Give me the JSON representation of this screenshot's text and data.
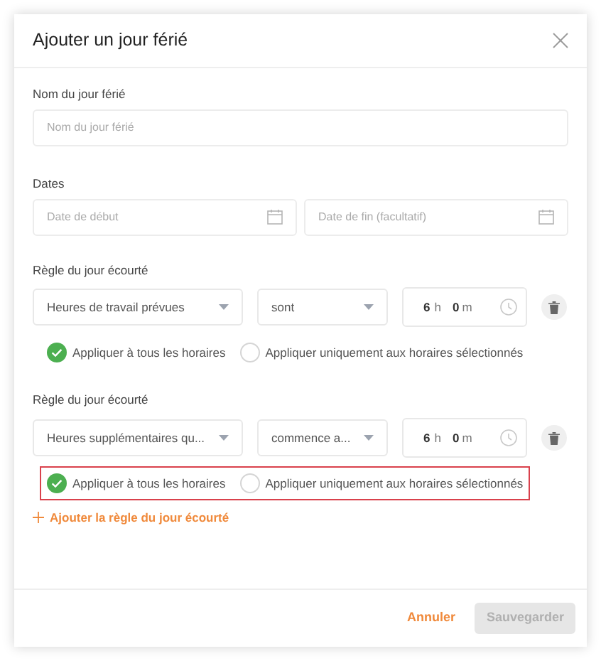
{
  "dialog": {
    "title": "Ajouter un jour férié"
  },
  "name_field": {
    "label": "Nom du jour férié",
    "placeholder": "Nom du jour férié"
  },
  "dates": {
    "label": "Dates",
    "start_placeholder": "Date de début",
    "end_placeholder": "Date de fin (facultatif)"
  },
  "rules": [
    {
      "label": "Règle du jour écourté",
      "type": "Heures de travail prévues",
      "operator": "sont",
      "hours": "6",
      "hours_unit": "h",
      "minutes": "0",
      "minutes_unit": "m",
      "highlighted": false,
      "options": [
        {
          "label": "Appliquer à tous les horaires",
          "selected": true
        },
        {
          "label": "Appliquer uniquement aux horaires sélectionnés",
          "selected": false
        }
      ]
    },
    {
      "label": "Règle du jour écourté",
      "type": "Heures supplémentaires qu...",
      "operator": "commence a...",
      "hours": "6",
      "hours_unit": "h",
      "minutes": "0",
      "minutes_unit": "m",
      "highlighted": true,
      "options": [
        {
          "label": "Appliquer à tous les horaires",
          "selected": true
        },
        {
          "label": "Appliquer uniquement aux horaires sélectionnés",
          "selected": false
        }
      ]
    }
  ],
  "add_rule": {
    "label": "Ajouter la règle du jour écourté"
  },
  "footer": {
    "cancel": "Annuler",
    "save": "Sauvegarder",
    "save_disabled": true
  }
}
